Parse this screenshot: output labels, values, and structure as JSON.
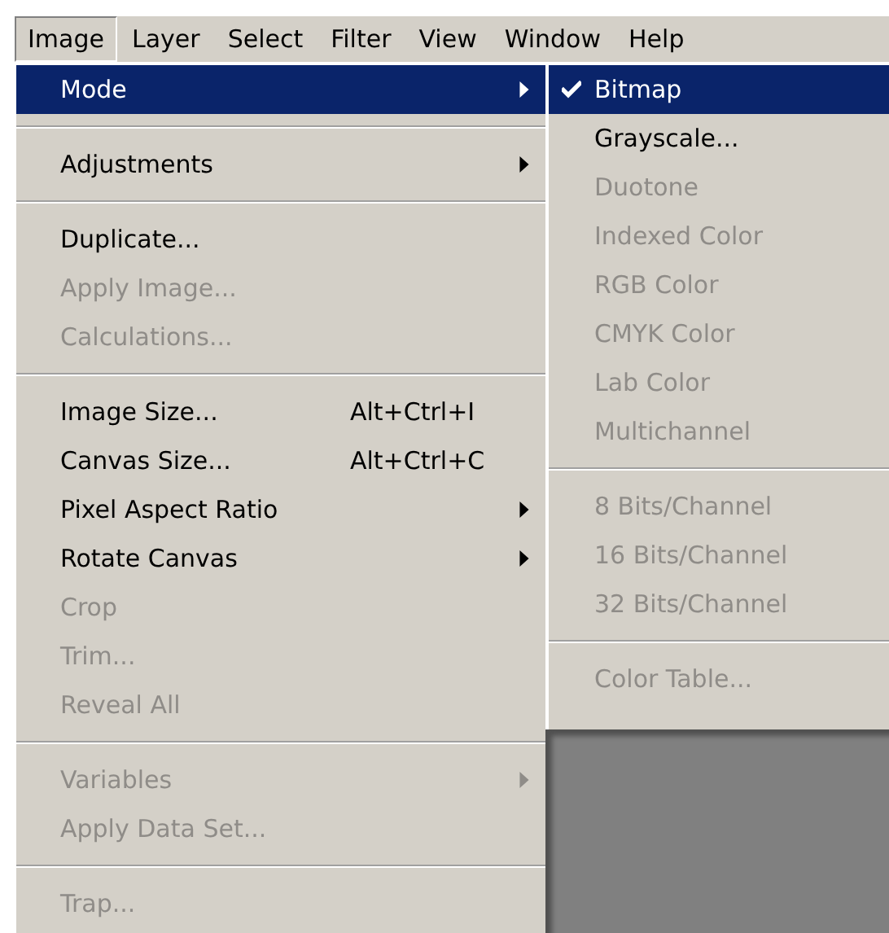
{
  "menubar": [
    {
      "label": "Image",
      "selected": true
    },
    {
      "label": "Layer",
      "selected": false
    },
    {
      "label": "Select",
      "selected": false
    },
    {
      "label": "Filter",
      "selected": false
    },
    {
      "label": "View",
      "selected": false
    },
    {
      "label": "Window",
      "selected": false
    },
    {
      "label": "Help",
      "selected": false
    }
  ],
  "menu": [
    {
      "kind": "item",
      "label": "Mode",
      "selected": true,
      "disabled": false,
      "submenu": true
    },
    {
      "kind": "separator"
    },
    {
      "kind": "item",
      "label": "Adjustments",
      "selected": false,
      "disabled": false,
      "submenu": true
    },
    {
      "kind": "separator"
    },
    {
      "kind": "item",
      "label": "Duplicate...",
      "selected": false,
      "disabled": false,
      "submenu": false
    },
    {
      "kind": "item",
      "label": "Apply Image...",
      "selected": false,
      "disabled": true,
      "submenu": false
    },
    {
      "kind": "item",
      "label": "Calculations...",
      "selected": false,
      "disabled": true,
      "submenu": false
    },
    {
      "kind": "separator"
    },
    {
      "kind": "item",
      "label": "Image Size...",
      "shortcut": "Alt+Ctrl+I",
      "selected": false,
      "disabled": false,
      "submenu": false
    },
    {
      "kind": "item",
      "label": "Canvas Size...",
      "shortcut": "Alt+Ctrl+C",
      "selected": false,
      "disabled": false,
      "submenu": false
    },
    {
      "kind": "item",
      "label": "Pixel Aspect Ratio",
      "selected": false,
      "disabled": false,
      "submenu": true
    },
    {
      "kind": "item",
      "label": "Rotate Canvas",
      "selected": false,
      "disabled": false,
      "submenu": true
    },
    {
      "kind": "item",
      "label": "Crop",
      "selected": false,
      "disabled": true,
      "submenu": false
    },
    {
      "kind": "item",
      "label": "Trim...",
      "selected": false,
      "disabled": true,
      "submenu": false
    },
    {
      "kind": "item",
      "label": "Reveal All",
      "selected": false,
      "disabled": true,
      "submenu": false
    },
    {
      "kind": "separator"
    },
    {
      "kind": "item",
      "label": "Variables",
      "selected": false,
      "disabled": true,
      "submenu": true
    },
    {
      "kind": "item",
      "label": "Apply Data Set...",
      "selected": false,
      "disabled": true,
      "submenu": false
    },
    {
      "kind": "separator"
    },
    {
      "kind": "item",
      "label": "Trap...",
      "selected": false,
      "disabled": true,
      "submenu": false
    }
  ],
  "submenu": [
    {
      "kind": "item",
      "label": "Bitmap",
      "selected": true,
      "disabled": false,
      "checked": true
    },
    {
      "kind": "item",
      "label": "Grayscale...",
      "selected": false,
      "disabled": false,
      "checked": false
    },
    {
      "kind": "item",
      "label": "Duotone",
      "selected": false,
      "disabled": true,
      "checked": false
    },
    {
      "kind": "item",
      "label": "Indexed Color",
      "selected": false,
      "disabled": true,
      "checked": false
    },
    {
      "kind": "item",
      "label": "RGB Color",
      "selected": false,
      "disabled": true,
      "checked": false
    },
    {
      "kind": "item",
      "label": "CMYK Color",
      "selected": false,
      "disabled": true,
      "checked": false
    },
    {
      "kind": "item",
      "label": "Lab Color",
      "selected": false,
      "disabled": true,
      "checked": false
    },
    {
      "kind": "item",
      "label": "Multichannel",
      "selected": false,
      "disabled": true,
      "checked": false
    },
    {
      "kind": "separator"
    },
    {
      "kind": "item",
      "label": "8 Bits/Channel",
      "selected": false,
      "disabled": true,
      "checked": false
    },
    {
      "kind": "item",
      "label": "16 Bits/Channel",
      "selected": false,
      "disabled": true,
      "checked": false
    },
    {
      "kind": "item",
      "label": "32 Bits/Channel",
      "selected": false,
      "disabled": true,
      "checked": false
    },
    {
      "kind": "separator"
    },
    {
      "kind": "item",
      "label": "Color Table...",
      "selected": false,
      "disabled": true,
      "checked": false
    }
  ]
}
